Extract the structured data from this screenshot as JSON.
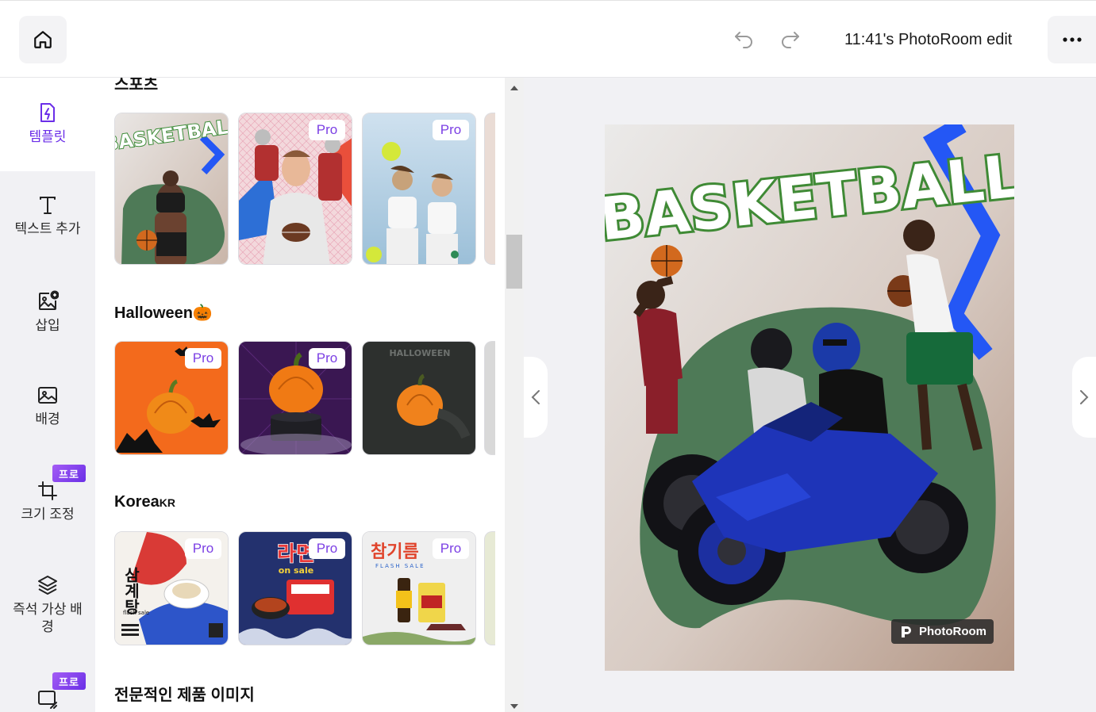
{
  "header": {
    "document_title": "11:41's PhotoRoom edit",
    "home_icon": "home-icon",
    "undo_icon": "undo-icon",
    "redo_icon": "redo-icon",
    "more_icon": "more-horizontal-icon"
  },
  "nav": {
    "items": [
      {
        "label": "템플릿",
        "icon": "template-icon",
        "active": true
      },
      {
        "label": "텍스트 추가",
        "icon": "text-icon"
      },
      {
        "label": "삽입",
        "icon": "insert-image-icon"
      },
      {
        "label": "배경",
        "icon": "background-icon"
      },
      {
        "label": "크기 조정",
        "icon": "crop-icon",
        "badge": "프로"
      },
      {
        "label": "즉석 가상 배경",
        "icon": "layers-icon"
      },
      {
        "label": "",
        "icon": "resize-icon",
        "badge": "프로"
      }
    ]
  },
  "panel": {
    "sections": [
      {
        "title": "스포츠",
        "templates": [
          {
            "name": "BASKETBALL",
            "pro": false
          },
          {
            "name": "football player",
            "pro": true,
            "badge": "Pro"
          },
          {
            "name": "tennis players",
            "pro": true,
            "badge": "Pro"
          }
        ]
      },
      {
        "title": "Halloween🎃",
        "templates": [
          {
            "name": "pumpkin orange bats",
            "pro": true,
            "badge": "Pro"
          },
          {
            "name": "pumpkin purple smoke",
            "pro": true,
            "badge": "Pro"
          },
          {
            "name": "HALLOWEEN",
            "pro": false
          }
        ]
      },
      {
        "title": "Korea",
        "title_suffix": "KR",
        "templates": [
          {
            "name": "삼계탕",
            "sub": "flash sale",
            "pro": true,
            "badge": "Pro"
          },
          {
            "name": "라면",
            "sub": "on sale",
            "pro": true,
            "badge": "Pro"
          },
          {
            "name": "참기름",
            "sub": "FLASH SALE",
            "pro": true,
            "badge": "Pro"
          }
        ]
      },
      {
        "title": "전문적인 제품 이미지",
        "templates": []
      }
    ]
  },
  "canvas": {
    "poster_title": "BASKETBALL",
    "watermark": "PhotoRoom",
    "colors": {
      "accent_purple": "#7b3fe4",
      "poster_green": "#4e7a57",
      "chevron_blue": "#2457f5"
    }
  }
}
